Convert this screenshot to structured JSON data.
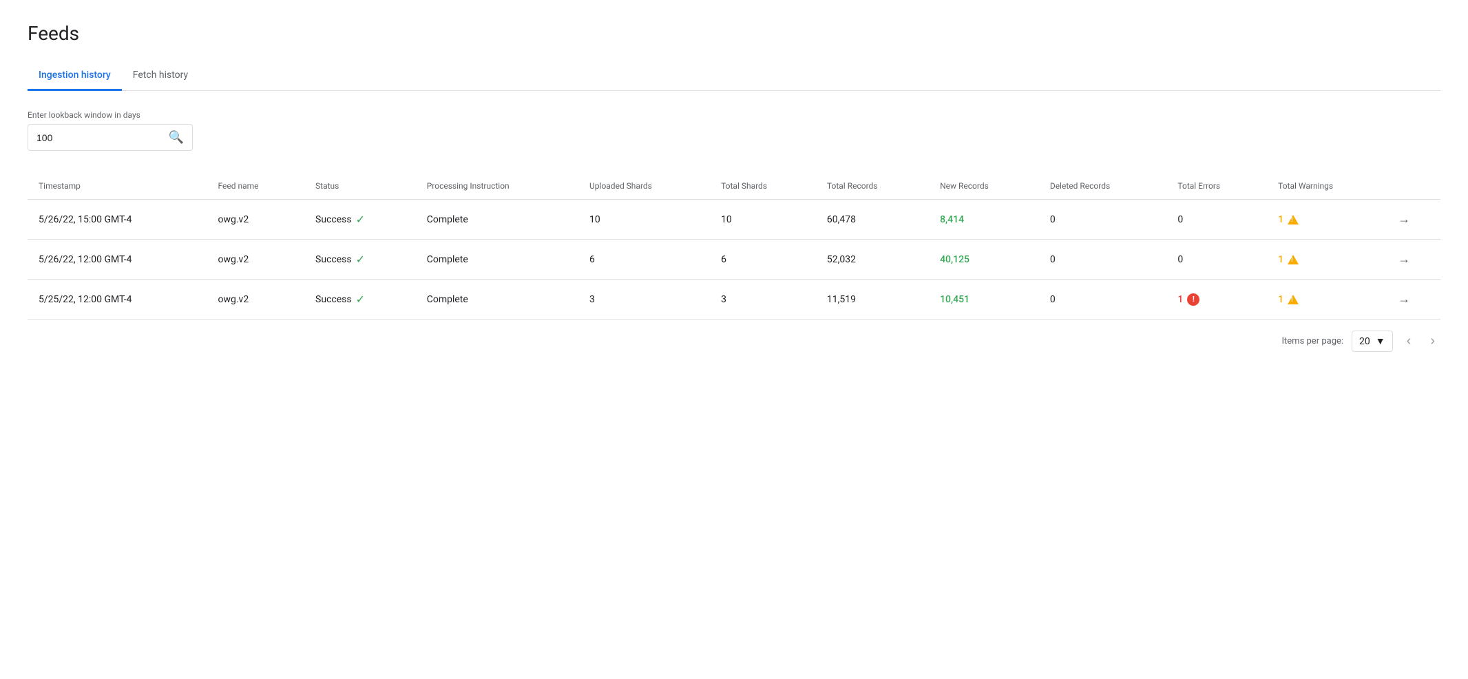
{
  "page": {
    "title": "Feeds"
  },
  "tabs": [
    {
      "label": "Ingestion history",
      "active": true,
      "id": "ingestion-history"
    },
    {
      "label": "Fetch history",
      "active": false,
      "id": "fetch-history"
    }
  ],
  "search": {
    "label": "Enter lookback window in days",
    "value": "100",
    "placeholder": ""
  },
  "table": {
    "columns": [
      {
        "id": "timestamp",
        "label": "Timestamp"
      },
      {
        "id": "feed-name",
        "label": "Feed name"
      },
      {
        "id": "status",
        "label": "Status"
      },
      {
        "id": "processing-instruction",
        "label": "Processing Instruction"
      },
      {
        "id": "uploaded-shards",
        "label": "Uploaded Shards"
      },
      {
        "id": "total-shards",
        "label": "Total Shards"
      },
      {
        "id": "total-records",
        "label": "Total Records"
      },
      {
        "id": "new-records",
        "label": "New Records"
      },
      {
        "id": "deleted-records",
        "label": "Deleted Records"
      },
      {
        "id": "total-errors",
        "label": "Total Errors"
      },
      {
        "id": "total-warnings",
        "label": "Total Warnings"
      },
      {
        "id": "action",
        "label": ""
      }
    ],
    "rows": [
      {
        "timestamp": "5/26/22, 15:00 GMT-4",
        "feed_name": "owg.v2",
        "status": "Success",
        "processing_instruction": "Complete",
        "uploaded_shards": "10",
        "total_shards": "10",
        "total_records": "60,478",
        "new_records": "8,414",
        "new_records_highlight": true,
        "deleted_records": "0",
        "total_errors": "0",
        "total_errors_type": "none",
        "total_warnings": "1",
        "total_warnings_type": "warning"
      },
      {
        "timestamp": "5/26/22, 12:00 GMT-4",
        "feed_name": "owg.v2",
        "status": "Success",
        "processing_instruction": "Complete",
        "uploaded_shards": "6",
        "total_shards": "6",
        "total_records": "52,032",
        "new_records": "40,125",
        "new_records_highlight": true,
        "deleted_records": "0",
        "total_errors": "0",
        "total_errors_type": "none",
        "total_warnings": "1",
        "total_warnings_type": "warning"
      },
      {
        "timestamp": "5/25/22, 12:00 GMT-4",
        "feed_name": "owg.v2",
        "status": "Success",
        "processing_instruction": "Complete",
        "uploaded_shards": "3",
        "total_shards": "3",
        "total_records": "11,519",
        "new_records": "10,451",
        "new_records_highlight": true,
        "deleted_records": "0",
        "total_errors": "1",
        "total_errors_type": "error",
        "total_warnings": "1",
        "total_warnings_type": "warning"
      }
    ]
  },
  "pagination": {
    "items_per_page_label": "Items per page:",
    "items_per_page_value": "20"
  }
}
